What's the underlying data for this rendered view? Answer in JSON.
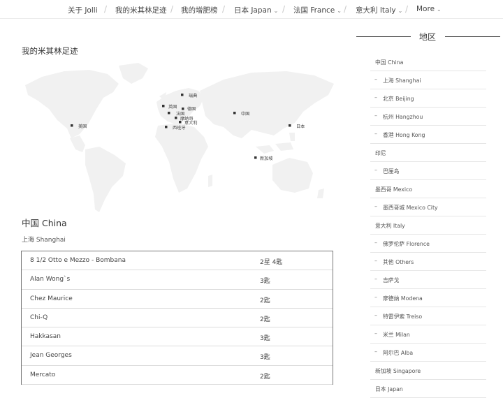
{
  "nav": {
    "items": [
      {
        "label": "关于 Jolli",
        "dropdown": false
      },
      {
        "label": "我的米其林足迹",
        "dropdown": false
      },
      {
        "label": "我的增肥榜",
        "dropdown": false
      },
      {
        "label": "日本 Japan",
        "dropdown": true
      },
      {
        "label": "法国 France",
        "dropdown": true
      },
      {
        "label": "意大利 Italy",
        "dropdown": true
      },
      {
        "label": "More",
        "dropdown": true
      }
    ]
  },
  "main": {
    "section_title": "我的米其林足迹",
    "map_pins": [
      "瑞典",
      "英国",
      "德国",
      "法国",
      "摩纳哥",
      "意大利",
      "西班牙",
      "美国",
      "中国",
      "日本",
      "新加坡"
    ],
    "country_title": "中国 China",
    "city_title": "上海 Shanghai",
    "restaurants": [
      {
        "name": "8 1/2 Otto e Mezzo - Bombana",
        "stars": "2星 4匙"
      },
      {
        "name": "Alan Wong`s",
        "stars": "3匙"
      },
      {
        "name": "Chez Maurice",
        "stars": "2匙"
      },
      {
        "name": "Chi-Q",
        "stars": "2匙"
      },
      {
        "name": "Hakkasan",
        "stars": "3匙"
      },
      {
        "name": "Jean Georges",
        "stars": "3匙"
      },
      {
        "name": "Mercato",
        "stars": "2匙"
      }
    ]
  },
  "sidebar": {
    "heading": "地区",
    "items": [
      {
        "label": "中国 China",
        "level": "top"
      },
      {
        "label": "上海 Shanghai",
        "level": "sub"
      },
      {
        "label": "北京 Beijing",
        "level": "sub"
      },
      {
        "label": "杭州 Hangzhou",
        "level": "sub"
      },
      {
        "label": "香港 Hong Kong",
        "level": "sub"
      },
      {
        "label": "印尼",
        "level": "top"
      },
      {
        "label": "巴厘岛",
        "level": "sub"
      },
      {
        "label": "墨西哥 Mexico",
        "level": "top"
      },
      {
        "label": "墨西哥城 Mexico City",
        "level": "sub"
      },
      {
        "label": "意大利 Italy",
        "level": "top"
      },
      {
        "label": "佛罗伦萨 Florence",
        "level": "sub"
      },
      {
        "label": "其他 Others",
        "level": "sub"
      },
      {
        "label": "吉萨戈",
        "level": "sub"
      },
      {
        "label": "摩德纳 Modena",
        "level": "sub"
      },
      {
        "label": "特雷伊索 Treiso",
        "level": "sub"
      },
      {
        "label": "米兰 Milan",
        "level": "sub"
      },
      {
        "label": "阿尔巴 Alba",
        "level": "sub"
      },
      {
        "label": "新加坡 Singapore",
        "level": "top"
      },
      {
        "label": "日本 Japan",
        "level": "top"
      }
    ]
  }
}
